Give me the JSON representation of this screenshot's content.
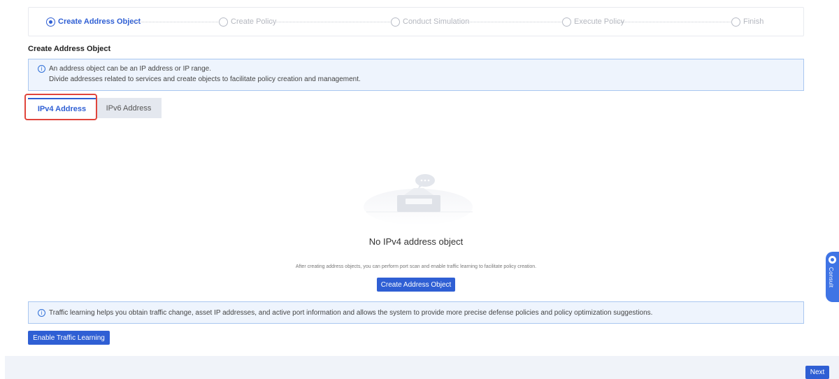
{
  "stepper": {
    "steps": [
      {
        "label": "Create Address Object",
        "state": "active"
      },
      {
        "label": "Create Policy",
        "state": "pending"
      },
      {
        "label": "Conduct Simulation",
        "state": "pending"
      },
      {
        "label": "Execute Policy",
        "state": "pending"
      },
      {
        "label": "Finish",
        "state": "pending"
      }
    ]
  },
  "section": {
    "title": "Create Address Object"
  },
  "info_top": {
    "line1": "An address object can be an IP address or IP range.",
    "line2": "Divide addresses related to services and create objects to facilitate policy creation and management."
  },
  "tabs": [
    {
      "label": "IPv4 Address",
      "active": true
    },
    {
      "label": "IPv6 Address",
      "active": false
    }
  ],
  "empty_state": {
    "title": "No IPv4 address object",
    "description": "After creating address objects, you can perform port scan and enable traffic learning to facilitate policy creation.",
    "button_label": "Create Address Object"
  },
  "info_bottom": {
    "text": "Traffic learning helps you obtain traffic change, asset IP addresses, and active port information and allows the system to provide more precise defense policies and policy optimization suggestions."
  },
  "traffic_button_label": "Enable Traffic Learning",
  "next_button_label": "Next",
  "consult_label": "Consult",
  "colors": {
    "primary": "#2f5fd4",
    "info_bg": "#eef4fd",
    "info_border": "#a9c7f0",
    "highlight": "#e0453c"
  }
}
